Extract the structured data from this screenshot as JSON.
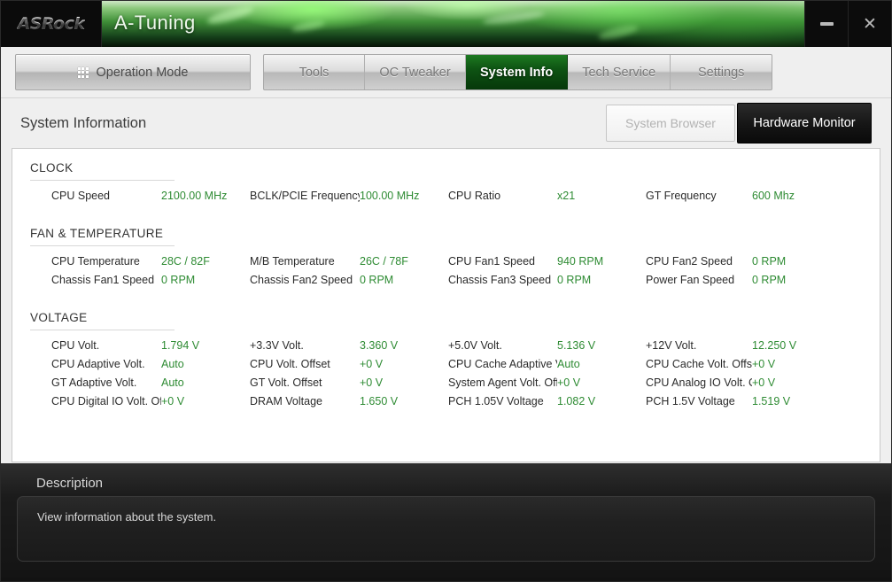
{
  "window": {
    "brand": "ASRock",
    "app_title": "A-Tuning",
    "minimize_label": "–",
    "close_label": "✕"
  },
  "toolbar": {
    "operation_mode_label": "Operation Mode",
    "tabs": [
      {
        "label": "Tools",
        "active": false
      },
      {
        "label": "OC Tweaker",
        "active": false
      },
      {
        "label": "System Info",
        "active": true
      },
      {
        "label": "Tech Service",
        "active": false
      },
      {
        "label": "Settings",
        "active": false
      }
    ]
  },
  "content": {
    "title": "System Information",
    "system_browser_label": "System Browser",
    "hardware_monitor_label": "Hardware Monitor"
  },
  "sections": [
    {
      "title": "CLOCK",
      "rows": [
        [
          {
            "label": "CPU Speed",
            "value": "2100.00 MHz"
          },
          {
            "label": "BCLK/PCIE Frequency",
            "value": "100.00 MHz"
          },
          {
            "label": "CPU Ratio",
            "value": "x21"
          },
          {
            "label": "GT Frequency",
            "value": "600 Mhz"
          }
        ]
      ]
    },
    {
      "title": "FAN & TEMPERATURE",
      "rows": [
        [
          {
            "label": "CPU Temperature",
            "value": "28C / 82F"
          },
          {
            "label": "M/B Temperature",
            "value": "26C / 78F"
          },
          {
            "label": "CPU Fan1 Speed",
            "value": "940 RPM"
          },
          {
            "label": "CPU Fan2 Speed",
            "value": "0 RPM"
          }
        ],
        [
          {
            "label": "Chassis Fan1 Speed",
            "value": "0 RPM"
          },
          {
            "label": "Chassis Fan2 Speed",
            "value": "0 RPM"
          },
          {
            "label": "Chassis Fan3 Speed",
            "value": "0 RPM"
          },
          {
            "label": "Power Fan Speed",
            "value": "0 RPM"
          }
        ]
      ]
    },
    {
      "title": "VOLTAGE",
      "rows": [
        [
          {
            "label": "CPU Volt.",
            "value": "1.794 V"
          },
          {
            "label": "+3.3V Volt.",
            "value": "3.360 V"
          },
          {
            "label": "+5.0V Volt.",
            "value": "5.136 V"
          },
          {
            "label": "+12V Volt.",
            "value": "12.250 V"
          }
        ],
        [
          {
            "label": "CPU Adaptive Volt.",
            "value": "Auto"
          },
          {
            "label": "CPU Volt. Offset",
            "value": "+0 V"
          },
          {
            "label": "CPU Cache Adaptive Volt.",
            "value": "Auto"
          },
          {
            "label": "CPU Cache Volt. Offset",
            "value": "+0 V"
          }
        ],
        [
          {
            "label": "GT Adaptive Volt.",
            "value": "Auto"
          },
          {
            "label": "GT Volt. Offset",
            "value": "+0 V"
          },
          {
            "label": "System Agent Volt. Offset",
            "value": "+0 V"
          },
          {
            "label": "CPU Analog IO Volt. Offset",
            "value": "+0 V"
          }
        ],
        [
          {
            "label": "CPU Digital IO Volt. Offset",
            "value": "+0 V"
          },
          {
            "label": "DRAM Voltage",
            "value": "1.650 V"
          },
          {
            "label": "PCH 1.05V Voltage",
            "value": "1.082 V"
          },
          {
            "label": "PCH 1.5V Voltage",
            "value": "1.519 V"
          }
        ]
      ]
    }
  ],
  "description": {
    "title": "Description",
    "text": "View information about the system."
  },
  "colors": {
    "value_green": "#2e8b33",
    "tab_active_green": "#0e5413",
    "banner_green": "#3f8f38"
  }
}
